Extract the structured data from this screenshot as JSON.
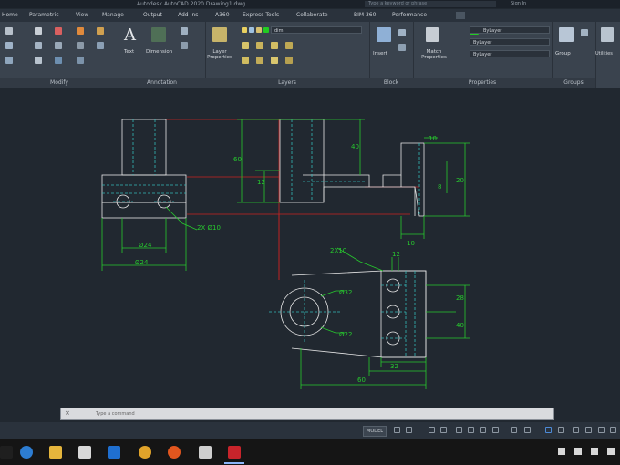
{
  "titlebar": {
    "title": "Autodesk AutoCAD 2020  Drawing1.dwg",
    "search": "Type a keyword or phrase",
    "signin": "Sign In"
  },
  "menu": {
    "tabs": [
      "Home",
      "Parametric",
      "View",
      "Manage",
      "Output",
      "Add-ins",
      "A360",
      "Express Tools",
      "Collaborate",
      "BIM 360",
      "Performance"
    ]
  },
  "ribbon": {
    "panels": {
      "modify": "Modify",
      "annotation": "Annotation",
      "layers": "Layers",
      "block": "Block",
      "properties": "Properties",
      "groups": "Groups"
    },
    "buttons": {
      "text": "Text",
      "dimension": "Dimension",
      "layer_properties": "Layer Properties",
      "insert": "Insert",
      "match_properties": "Match Properties",
      "group": "Group",
      "utilities": "Utilities"
    },
    "combos": {
      "layer": "dim",
      "color": "ByLayer",
      "linetype": "ByLayer",
      "lineweight": "ByLayer"
    },
    "colors": {
      "layer_swatch": "#22cc22",
      "ribbon_bg": "#3a434e",
      "dimension": "#27c92e",
      "centerline": "#35b8b8",
      "hidden": "#c82222",
      "object": "#e8e8e8"
    }
  },
  "drawing": {
    "dims": {
      "d_top_width": "Ø24",
      "d_bottom_width": "Ø24",
      "d_left_hole": "2X Ø10",
      "d_height_40": "40",
      "d_height_60": "60",
      "d_10": "10",
      "d_12": "12",
      "d_height_r": "6",
      "d_20": "20",
      "d_8": "8",
      "d_width_10": "10",
      "d_hole_label": "2X10",
      "d_r32": "Ø32",
      "d_r22": "Ø22",
      "d_12b": "12",
      "d_28": "28",
      "d_40": "40",
      "d_50": "60",
      "d_35": "32",
      "d_94": "60"
    }
  },
  "cmdline": {
    "placeholder": "Type a command"
  },
  "statusbar": {
    "model": "MODEL"
  }
}
